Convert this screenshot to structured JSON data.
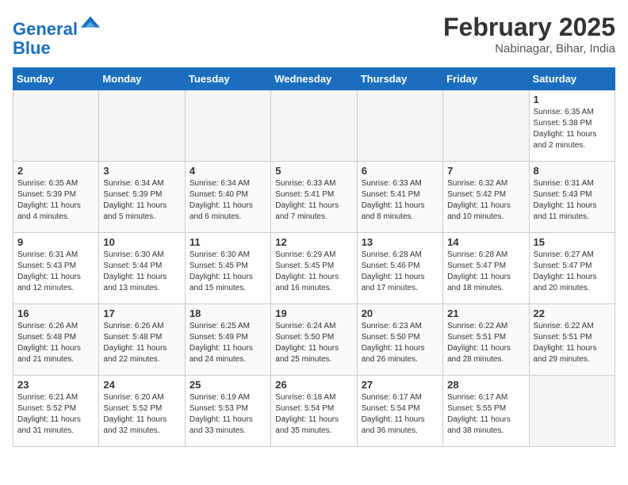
{
  "header": {
    "logo_line1": "General",
    "logo_line2": "Blue",
    "month": "February 2025",
    "location": "Nabinagar, Bihar, India"
  },
  "days_of_week": [
    "Sunday",
    "Monday",
    "Tuesday",
    "Wednesday",
    "Thursday",
    "Friday",
    "Saturday"
  ],
  "weeks": [
    [
      {
        "day": "",
        "info": ""
      },
      {
        "day": "",
        "info": ""
      },
      {
        "day": "",
        "info": ""
      },
      {
        "day": "",
        "info": ""
      },
      {
        "day": "",
        "info": ""
      },
      {
        "day": "",
        "info": ""
      },
      {
        "day": "1",
        "info": "Sunrise: 6:35 AM\nSunset: 5:38 PM\nDaylight: 11 hours\nand 2 minutes."
      }
    ],
    [
      {
        "day": "2",
        "info": "Sunrise: 6:35 AM\nSunset: 5:39 PM\nDaylight: 11 hours\nand 4 minutes."
      },
      {
        "day": "3",
        "info": "Sunrise: 6:34 AM\nSunset: 5:39 PM\nDaylight: 11 hours\nand 5 minutes."
      },
      {
        "day": "4",
        "info": "Sunrise: 6:34 AM\nSunset: 5:40 PM\nDaylight: 11 hours\nand 6 minutes."
      },
      {
        "day": "5",
        "info": "Sunrise: 6:33 AM\nSunset: 5:41 PM\nDaylight: 11 hours\nand 7 minutes."
      },
      {
        "day": "6",
        "info": "Sunrise: 6:33 AM\nSunset: 5:41 PM\nDaylight: 11 hours\nand 8 minutes."
      },
      {
        "day": "7",
        "info": "Sunrise: 6:32 AM\nSunset: 5:42 PM\nDaylight: 11 hours\nand 10 minutes."
      },
      {
        "day": "8",
        "info": "Sunrise: 6:31 AM\nSunset: 5:43 PM\nDaylight: 11 hours\nand 11 minutes."
      }
    ],
    [
      {
        "day": "9",
        "info": "Sunrise: 6:31 AM\nSunset: 5:43 PM\nDaylight: 11 hours\nand 12 minutes."
      },
      {
        "day": "10",
        "info": "Sunrise: 6:30 AM\nSunset: 5:44 PM\nDaylight: 11 hours\nand 13 minutes."
      },
      {
        "day": "11",
        "info": "Sunrise: 6:30 AM\nSunset: 5:45 PM\nDaylight: 11 hours\nand 15 minutes."
      },
      {
        "day": "12",
        "info": "Sunrise: 6:29 AM\nSunset: 5:45 PM\nDaylight: 11 hours\nand 16 minutes."
      },
      {
        "day": "13",
        "info": "Sunrise: 6:28 AM\nSunset: 5:46 PM\nDaylight: 11 hours\nand 17 minutes."
      },
      {
        "day": "14",
        "info": "Sunrise: 6:28 AM\nSunset: 5:47 PM\nDaylight: 11 hours\nand 18 minutes."
      },
      {
        "day": "15",
        "info": "Sunrise: 6:27 AM\nSunset: 5:47 PM\nDaylight: 11 hours\nand 20 minutes."
      }
    ],
    [
      {
        "day": "16",
        "info": "Sunrise: 6:26 AM\nSunset: 5:48 PM\nDaylight: 11 hours\nand 21 minutes."
      },
      {
        "day": "17",
        "info": "Sunrise: 6:26 AM\nSunset: 5:48 PM\nDaylight: 11 hours\nand 22 minutes."
      },
      {
        "day": "18",
        "info": "Sunrise: 6:25 AM\nSunset: 5:49 PM\nDaylight: 11 hours\nand 24 minutes."
      },
      {
        "day": "19",
        "info": "Sunrise: 6:24 AM\nSunset: 5:50 PM\nDaylight: 11 hours\nand 25 minutes."
      },
      {
        "day": "20",
        "info": "Sunrise: 6:23 AM\nSunset: 5:50 PM\nDaylight: 11 hours\nand 26 minutes."
      },
      {
        "day": "21",
        "info": "Sunrise: 6:22 AM\nSunset: 5:51 PM\nDaylight: 11 hours\nand 28 minutes."
      },
      {
        "day": "22",
        "info": "Sunrise: 6:22 AM\nSunset: 5:51 PM\nDaylight: 11 hours\nand 29 minutes."
      }
    ],
    [
      {
        "day": "23",
        "info": "Sunrise: 6:21 AM\nSunset: 5:52 PM\nDaylight: 11 hours\nand 31 minutes."
      },
      {
        "day": "24",
        "info": "Sunrise: 6:20 AM\nSunset: 5:52 PM\nDaylight: 11 hours\nand 32 minutes."
      },
      {
        "day": "25",
        "info": "Sunrise: 6:19 AM\nSunset: 5:53 PM\nDaylight: 11 hours\nand 33 minutes."
      },
      {
        "day": "26",
        "info": "Sunrise: 6:18 AM\nSunset: 5:54 PM\nDaylight: 11 hours\nand 35 minutes."
      },
      {
        "day": "27",
        "info": "Sunrise: 6:17 AM\nSunset: 5:54 PM\nDaylight: 11 hours\nand 36 minutes."
      },
      {
        "day": "28",
        "info": "Sunrise: 6:17 AM\nSunset: 5:55 PM\nDaylight: 11 hours\nand 38 minutes."
      },
      {
        "day": "",
        "info": ""
      }
    ]
  ]
}
